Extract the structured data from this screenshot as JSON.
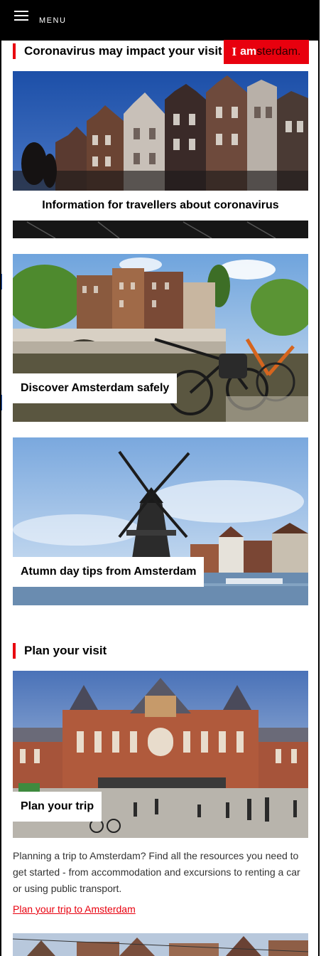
{
  "header": {
    "menu_label": "MENU",
    "logo_text_i": "I",
    "logo_text_am": "am",
    "logo_text_rest": "sterdam."
  },
  "covid_section": {
    "title": "Coronavirus may impact your visit t",
    "cards": [
      {
        "caption": "Information for travellers about coronavirus"
      },
      {
        "caption": "Discover Amsterdam safely"
      },
      {
        "caption": "Atumn day tips from Amsterdam"
      }
    ]
  },
  "plan_section": {
    "title": "Plan your visit",
    "card_caption": "Plan your trip",
    "description": "Planning a trip to Amsterdam? Find all the resources you need to get started - from accommodation and excursions to renting a car or using public transport.",
    "link": "Plan your trip to Amsterdam"
  },
  "colors": {
    "brand_red": "#e8000e",
    "header_bg": "#000000",
    "link": "#e8000e"
  },
  "icons": [
    "hamburger-icon",
    "amsterdam-logo"
  ]
}
